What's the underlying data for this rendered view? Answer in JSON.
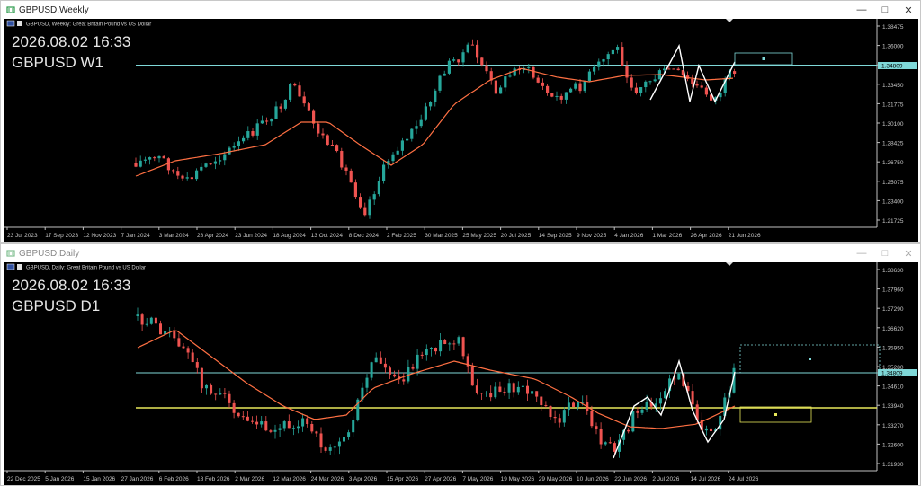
{
  "windows": [
    {
      "id": "w1",
      "title": "GBPUSD,Weekly",
      "active": true,
      "chart_label": "GBPUSD, Weekly:  Great Britain Pound vs US Dollar",
      "timestamp": "2026.08.02 16:33",
      "symbol_tf": "GBPUSD W1",
      "price_ticks": [
        "1.38475",
        "1.36000",
        "1.35125",
        "1.33450",
        "1.31775",
        "1.30100",
        "1.28425",
        "1.26750",
        "1.25075",
        "1.23400",
        "1.21725"
      ],
      "current_price": "1.34809",
      "date_ticks": [
        "23 Jul 2023",
        "17 Sep 2023",
        "12 Nov 2023",
        "7 Jan 2024",
        "3 Mar 2024",
        "28 Apr 2024",
        "23 Jun 2024",
        "18 Aug 2024",
        "13 Oct 2024",
        "8 Dec 2024",
        "2 Feb 2025",
        "30 Mar 2025",
        "25 May 2025",
        "20 Jul 2025",
        "14 Sep 2025",
        "9 Nov 2025",
        "4 Jan 2026",
        "1 Mar 2026",
        "26 Apr 2026",
        "21 Jun 2026"
      ],
      "colors": {
        "bull": "#26a69a",
        "bear": "#ef5350",
        "ma": "#ff7043",
        "hline": "#7fd8d8",
        "zigzag": "#ffffff"
      }
    },
    {
      "id": "w2",
      "title": "GBPUSD,Daily",
      "active": false,
      "chart_label": "GBPUSD, Daily:  Great Britain Pound vs US Dollar",
      "timestamp": "2026.08.02 16:33",
      "symbol_tf": "GBPUSD D1",
      "price_ticks": [
        "1.38630",
        "1.37960",
        "1.37290",
        "1.36620",
        "1.35950",
        "1.35280",
        "1.34610",
        "1.33940",
        "1.33270",
        "1.32600",
        "1.31930"
      ],
      "current_price": "1.34809",
      "date_ticks": [
        "22 Dec 2025",
        "5 Jan 2026",
        "15 Jan 2026",
        "27 Jan 2026",
        "6 Feb 2026",
        "18 Feb 2026",
        "2 Mar 2026",
        "12 Mar 2026",
        "24 Mar 2026",
        "3 Apr 2026",
        "15 Apr 2026",
        "27 Apr 2026",
        "7 May 2026",
        "19 May 2026",
        "29 May 2026",
        "10 Jun 2026",
        "22 Jun 2026",
        "2 Jul 2026",
        "14 Jul 2026",
        "24 Jul 2026"
      ],
      "colors": {
        "bull": "#26a69a",
        "bear": "#ef5350",
        "ma": "#ff7043",
        "hline": "#7fd8d8",
        "yline": "#e8e85a",
        "zigzag": "#ffffff"
      }
    }
  ]
}
